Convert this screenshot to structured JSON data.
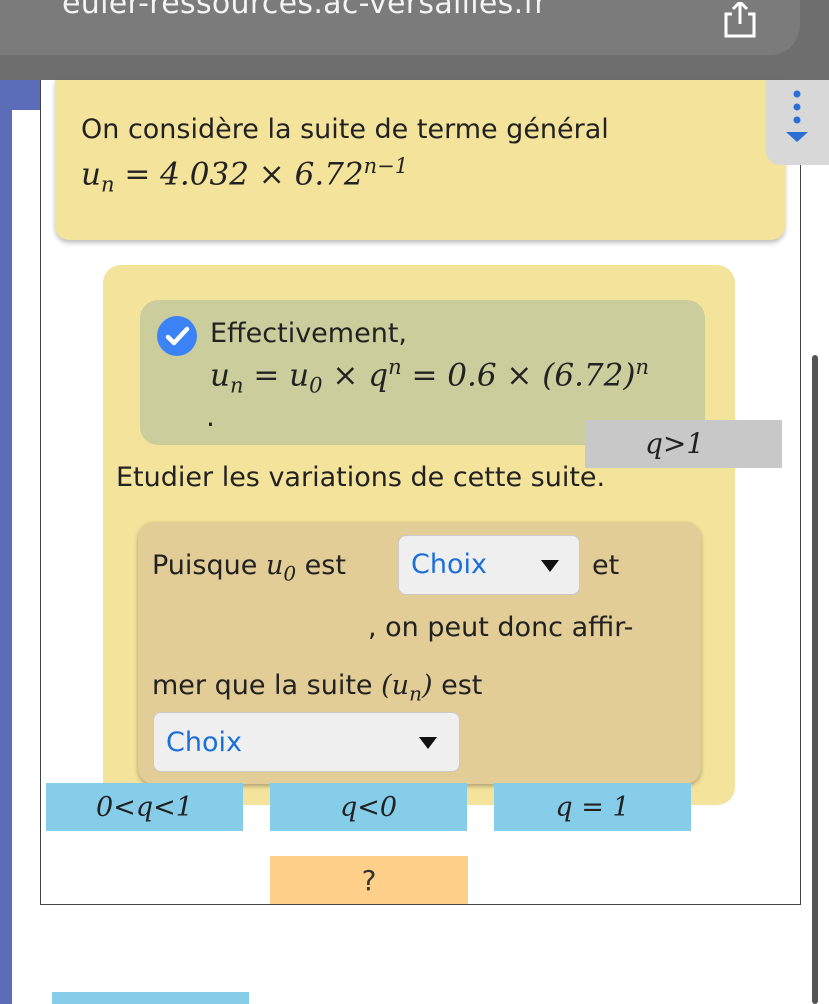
{
  "browser": {
    "url": "euler-ressources.ac-versailles.fr",
    "share_icon": "share-icon"
  },
  "question": {
    "line1": "On considère la suite de terme général",
    "formula_lhs": "u",
    "formula_sub": "n",
    "formula_rhs": " = 4.032 × 6.72",
    "formula_sup": "n−1"
  },
  "menu": {
    "icon": "vertical-dots-download-icon"
  },
  "feedback": {
    "icon": "check-circle-icon",
    "title": "Effectivement,",
    "formula": "u",
    "sub_n": "n",
    "mid": " = u",
    "sub_0": "0",
    "mid2": " × q",
    "sup_n": "n",
    "tail": " = 0.6 × (6.72)",
    "sup_n2": "n",
    "dot": "."
  },
  "hint_chip": "q>1",
  "prompt": "Etudier les variations de cette suite.",
  "answer": {
    "puisque": "Puisque ",
    "u": "u",
    "u_sub": "0",
    "est": " est",
    "select1": "Choix",
    "et": "et",
    "line2": ", on peut donc affir-",
    "line3_a": "mer que la suite ",
    "line3_u": "(u",
    "line3_sub": "n",
    "line3_close": ")",
    "line3_b": " est",
    "select2": "Choix"
  },
  "chips": [
    "0<q<1",
    "q<0",
    "q = 1"
  ],
  "help_button": "?"
}
